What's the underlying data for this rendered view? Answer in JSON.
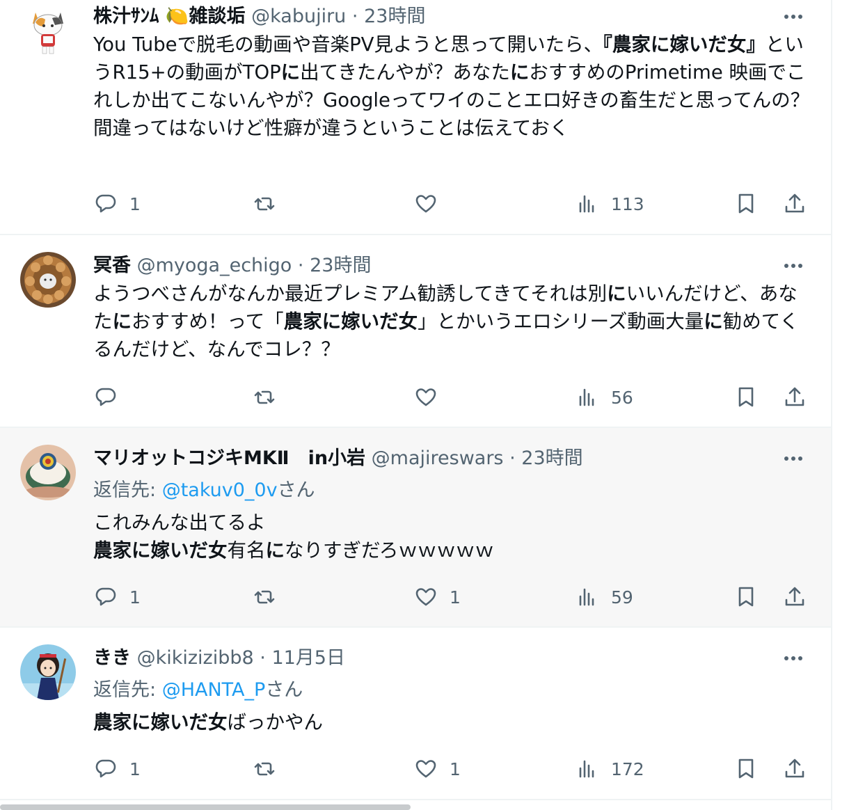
{
  "tweets": [
    {
      "name": "株汁ｻﾝﾑ 🍋雑談垢",
      "handle": "@kabujiru",
      "sep": "·",
      "time": "23時間",
      "reply_prefix": "",
      "reply_handle": "",
      "reply_suffix": "",
      "body": [
        {
          "t": "You Tubeで脱毛の動画や音楽PV見ようと思って開いたら、",
          "b": false
        },
        {
          "t": "『農家に嫁いだ女』",
          "b": true
        },
        {
          "t": "というR15+の動画がTOP",
          "b": false
        },
        {
          "t": "に",
          "b": true
        },
        {
          "t": "出てきたんやが？あなた",
          "b": false
        },
        {
          "t": "に",
          "b": true
        },
        {
          "t": "おすすめのPrimetime 映画でこれしか出てこないんやが？Googleってワイのことエロ好きの畜生だと思ってんの？間違ってはないけど性癖が違うということは伝えておく",
          "b": false
        }
      ],
      "reply_count": "1",
      "retweet_count": "",
      "like_count": "",
      "view_count": "113"
    },
    {
      "name": "冥香",
      "handle": "@myoga_echigo",
      "sep": "·",
      "time": "23時間",
      "reply_prefix": "",
      "reply_handle": "",
      "reply_suffix": "",
      "body": [
        {
          "t": "ようつべさんがなんか最近プレミアム勧誘してきてそれは別",
          "b": false
        },
        {
          "t": "に",
          "b": true
        },
        {
          "t": "いいんだけど、あなた",
          "b": false
        },
        {
          "t": "に",
          "b": true
        },
        {
          "t": "おすすめ！って「",
          "b": false
        },
        {
          "t": "農家に嫁いだ女",
          "b": true
        },
        {
          "t": "」とかいうエロシリーズ動画大量",
          "b": false
        },
        {
          "t": "に",
          "b": true
        },
        {
          "t": "勧めてくるんだけど、なんでコレ？？",
          "b": false
        }
      ],
      "reply_count": "",
      "retweet_count": "",
      "like_count": "",
      "view_count": "56"
    },
    {
      "name": "マリオットコジキMKⅡ　in小岩",
      "handle": "@majireswars",
      "sep": "·",
      "time": "23時間",
      "reply_prefix": "返信先: ",
      "reply_handle": "@takuv0_0v",
      "reply_suffix": "さん",
      "body": [
        {
          "t": "これみんな出てるよ",
          "b": false
        },
        {
          "t": "\n",
          "b": false
        },
        {
          "t": "農家に嫁いだ女",
          "b": true
        },
        {
          "t": "有名",
          "b": false
        },
        {
          "t": "に",
          "b": true
        },
        {
          "t": "なりすぎだろｗｗｗｗｗ",
          "b": false
        }
      ],
      "reply_count": "1",
      "retweet_count": "",
      "like_count": "1",
      "view_count": "59"
    },
    {
      "name": "きき",
      "handle": "@kikizizibb8",
      "sep": "·",
      "time": "11月5日",
      "reply_prefix": "返信先: ",
      "reply_handle": "@HANTA_P",
      "reply_suffix": "さん",
      "body": [
        {
          "t": "農家に嫁いだ女",
          "b": true
        },
        {
          "t": "ばっかやん",
          "b": false
        }
      ],
      "reply_count": "1",
      "retweet_count": "",
      "like_count": "1",
      "view_count": "172"
    }
  ],
  "icons": {
    "more": "more-dots-icon",
    "reply": "reply-bubble-icon",
    "retweet": "retweet-arrows-icon",
    "like": "heart-icon",
    "views": "views-bar-chart-icon",
    "bookmark": "bookmark-icon",
    "share": "share-upload-icon"
  },
  "colors": {
    "text": "#0f1419",
    "secondary": "#536471",
    "link": "#1d9bf0",
    "highlight_bg": "#f7f7f7",
    "divider": "#eff3f4"
  }
}
